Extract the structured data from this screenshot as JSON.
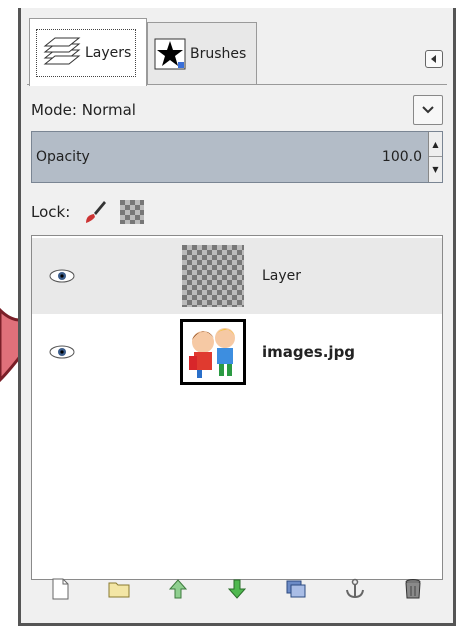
{
  "tabs": [
    {
      "label": "Layers",
      "icon": "layers-icon",
      "active": true
    },
    {
      "label": "Brushes",
      "icon": "brush-star-icon",
      "active": false
    }
  ],
  "mode": {
    "label": "Mode: Normal"
  },
  "opacity": {
    "label": "Opacity",
    "value": "100.0"
  },
  "lock": {
    "label": "Lock:"
  },
  "layers": [
    {
      "name": "Layer",
      "visible": true,
      "selected": true,
      "thumbnail": "transparent-checker"
    },
    {
      "name": "images.jpg",
      "visible": true,
      "selected": false,
      "thumbnail": "cartoon-kids-image"
    }
  ],
  "toolbar_icons": [
    "new-layer-icon",
    "new-group-icon",
    "raise-layer-icon",
    "lower-layer-icon",
    "duplicate-layer-icon",
    "anchor-layer-icon",
    "delete-layer-icon"
  ],
  "colors": {
    "opacity_bar": "#b3bcc7",
    "selected_row": "#e9e9e9",
    "callout": "#e0707a"
  }
}
